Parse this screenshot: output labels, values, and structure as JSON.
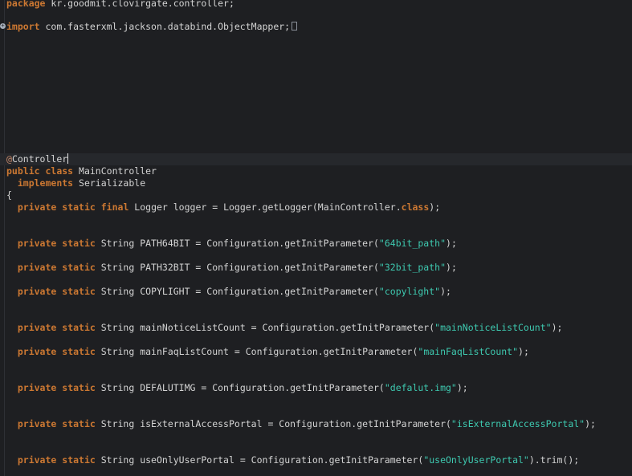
{
  "editor": {
    "lines": {
      "package_kw": "package",
      "package_name": " kr.goodmit.clovirgate.controller;",
      "import_kw": "import",
      "import_name": " com.fasterxml.jackson.databind.ObjectMapper;",
      "annotation_at": "@",
      "annotation_name": "Controller",
      "class_public": "public",
      "class_class": "class",
      "class_name": " MainController",
      "implements_kw": "implements",
      "implements_name": " Serializable",
      "open_brace": "{",
      "logger": {
        "private": "private",
        "static": "static",
        "final": "final",
        "body": " Logger logger = Logger.getLogger(MainController.",
        "class_kw": "class",
        "end": ");"
      },
      "path64": {
        "private": "private",
        "static": "static",
        "pre": " String PATH64BIT = Configuration.getInitParameter(",
        "str": "\"64bit_path\"",
        "post": ");"
      },
      "path32": {
        "private": "private",
        "static": "static",
        "pre": " String PATH32BIT = Configuration.getInitParameter(",
        "str": "\"32bit_path\"",
        "post": ");"
      },
      "copylight": {
        "private": "private",
        "static": "static",
        "pre": " String COPYLIGHT = Configuration.getInitParameter(",
        "str": "\"copylight\"",
        "post": ");"
      },
      "notice": {
        "private": "private",
        "static": "static",
        "pre": " String mainNoticeListCount = Configuration.getInitParameter(",
        "str": "\"mainNoticeListCount\"",
        "post": ");"
      },
      "faq": {
        "private": "private",
        "static": "static",
        "pre": " String mainFaqListCount = Configuration.getInitParameter(",
        "str": "\"mainFaqListCount\"",
        "post": ");"
      },
      "img": {
        "private": "private",
        "static": "static",
        "pre": " String DEFALUTIMG = Configuration.getInitParameter(",
        "str": "\"defalut.img\"",
        "post": ");"
      },
      "external": {
        "private": "private",
        "static": "static",
        "pre": " String isExternalAccessPortal = Configuration.getInitParameter(",
        "str": "\"isExternalAccessPortal\"",
        "post": ");"
      },
      "useonly": {
        "private": "private",
        "static": "static",
        "pre": " String useOnlyUserPortal = Configuration.getInitParameter(",
        "str": "\"useOnlyUserPortal\"",
        "post": ").trim();"
      }
    }
  }
}
